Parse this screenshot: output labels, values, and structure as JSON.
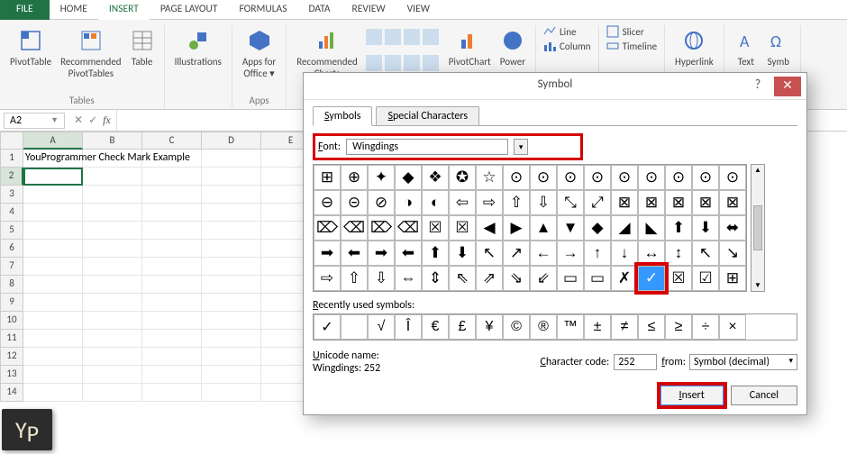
{
  "tabs": {
    "file": "FILE",
    "home": "HOME",
    "insert": "INSERT",
    "page_layout": "PAGE LAYOUT",
    "formulas": "FORMULAS",
    "data": "DATA",
    "review": "REVIEW",
    "view": "VIEW"
  },
  "ribbon": {
    "pivot_table": "PivotTable",
    "rec_pivot": "Recommended\nPivotTables",
    "table": "Table",
    "tables_group": "Tables",
    "illustrations": "Illustrations",
    "apps": "Apps for\nOffice ▾",
    "apps_group": "Apps",
    "rec_charts": "Recommended\nCharts",
    "pivotchart": "PivotChart",
    "power": "Power",
    "sparklines_line": "Line",
    "sparklines_col": "Column",
    "filters_slicer": "Slicer",
    "filters_timeline": "Timeline",
    "hyperlink": "Hyperlink",
    "text": "Text",
    "symbol": "Symb"
  },
  "namebox": "A2",
  "columns": [
    "A",
    "B",
    "C",
    "D",
    "E"
  ],
  "rows_count": 14,
  "cell_a1": "YouProgrammer Check Mark Example",
  "dialog": {
    "title": "Symbol",
    "tab_symbols": "Symbols",
    "tab_special": "Special Characters",
    "font_label": "Font:",
    "font_value": "Wingdings",
    "symbols": [
      "⊞",
      "⊕",
      "✦",
      "◆",
      "❖",
      "✪",
      "☆",
      "⊙",
      "⊙",
      "⊙",
      "⊙",
      "⊙",
      "⊙",
      "⊙",
      "⊙",
      "⊙",
      "⊖",
      "⊝",
      "⊘",
      "◑",
      "◐",
      "⇦",
      "⇨",
      "⇧",
      "⇩",
      "⤡",
      "⤢",
      "⊠",
      "⊠",
      "⊠",
      "⊠",
      "⊠",
      "⌦",
      "⌫",
      "⌦",
      "⌫",
      "☒",
      "☒",
      "◀",
      "▶",
      "▲",
      "▼",
      "◆",
      "◢",
      "◣",
      "⬆",
      "⬇",
      "⬌",
      "➡",
      "⬅",
      "➡",
      "⬅",
      "⬆",
      "⬇",
      "↖",
      "↗",
      "←",
      "→",
      "↑",
      "↓",
      "↔",
      "↕",
      "↖",
      "↘",
      "⇨",
      "⇧",
      "⇩",
      "⇔",
      "⇕",
      "⇖",
      "⇗",
      "⇘",
      "⇙",
      "▭",
      "▭",
      "✗",
      "✓",
      "☒",
      "☑",
      "⊞"
    ],
    "selected_index": 76,
    "recent_label": "Recently used symbols:",
    "recent": [
      "✓",
      "",
      "√",
      "Î",
      "€",
      "£",
      "¥",
      "©",
      "®",
      "™",
      "±",
      "≠",
      "≤",
      "≥",
      "÷",
      "×"
    ],
    "uni_label": "Unicode name:",
    "uni_name": "Wingdings: 252",
    "char_code_label": "Character code:",
    "char_code": "252",
    "from_label": "from:",
    "from_value": "Symbol (decimal)",
    "insert": "Insert",
    "cancel": "Cancel"
  },
  "watermark": "YP"
}
